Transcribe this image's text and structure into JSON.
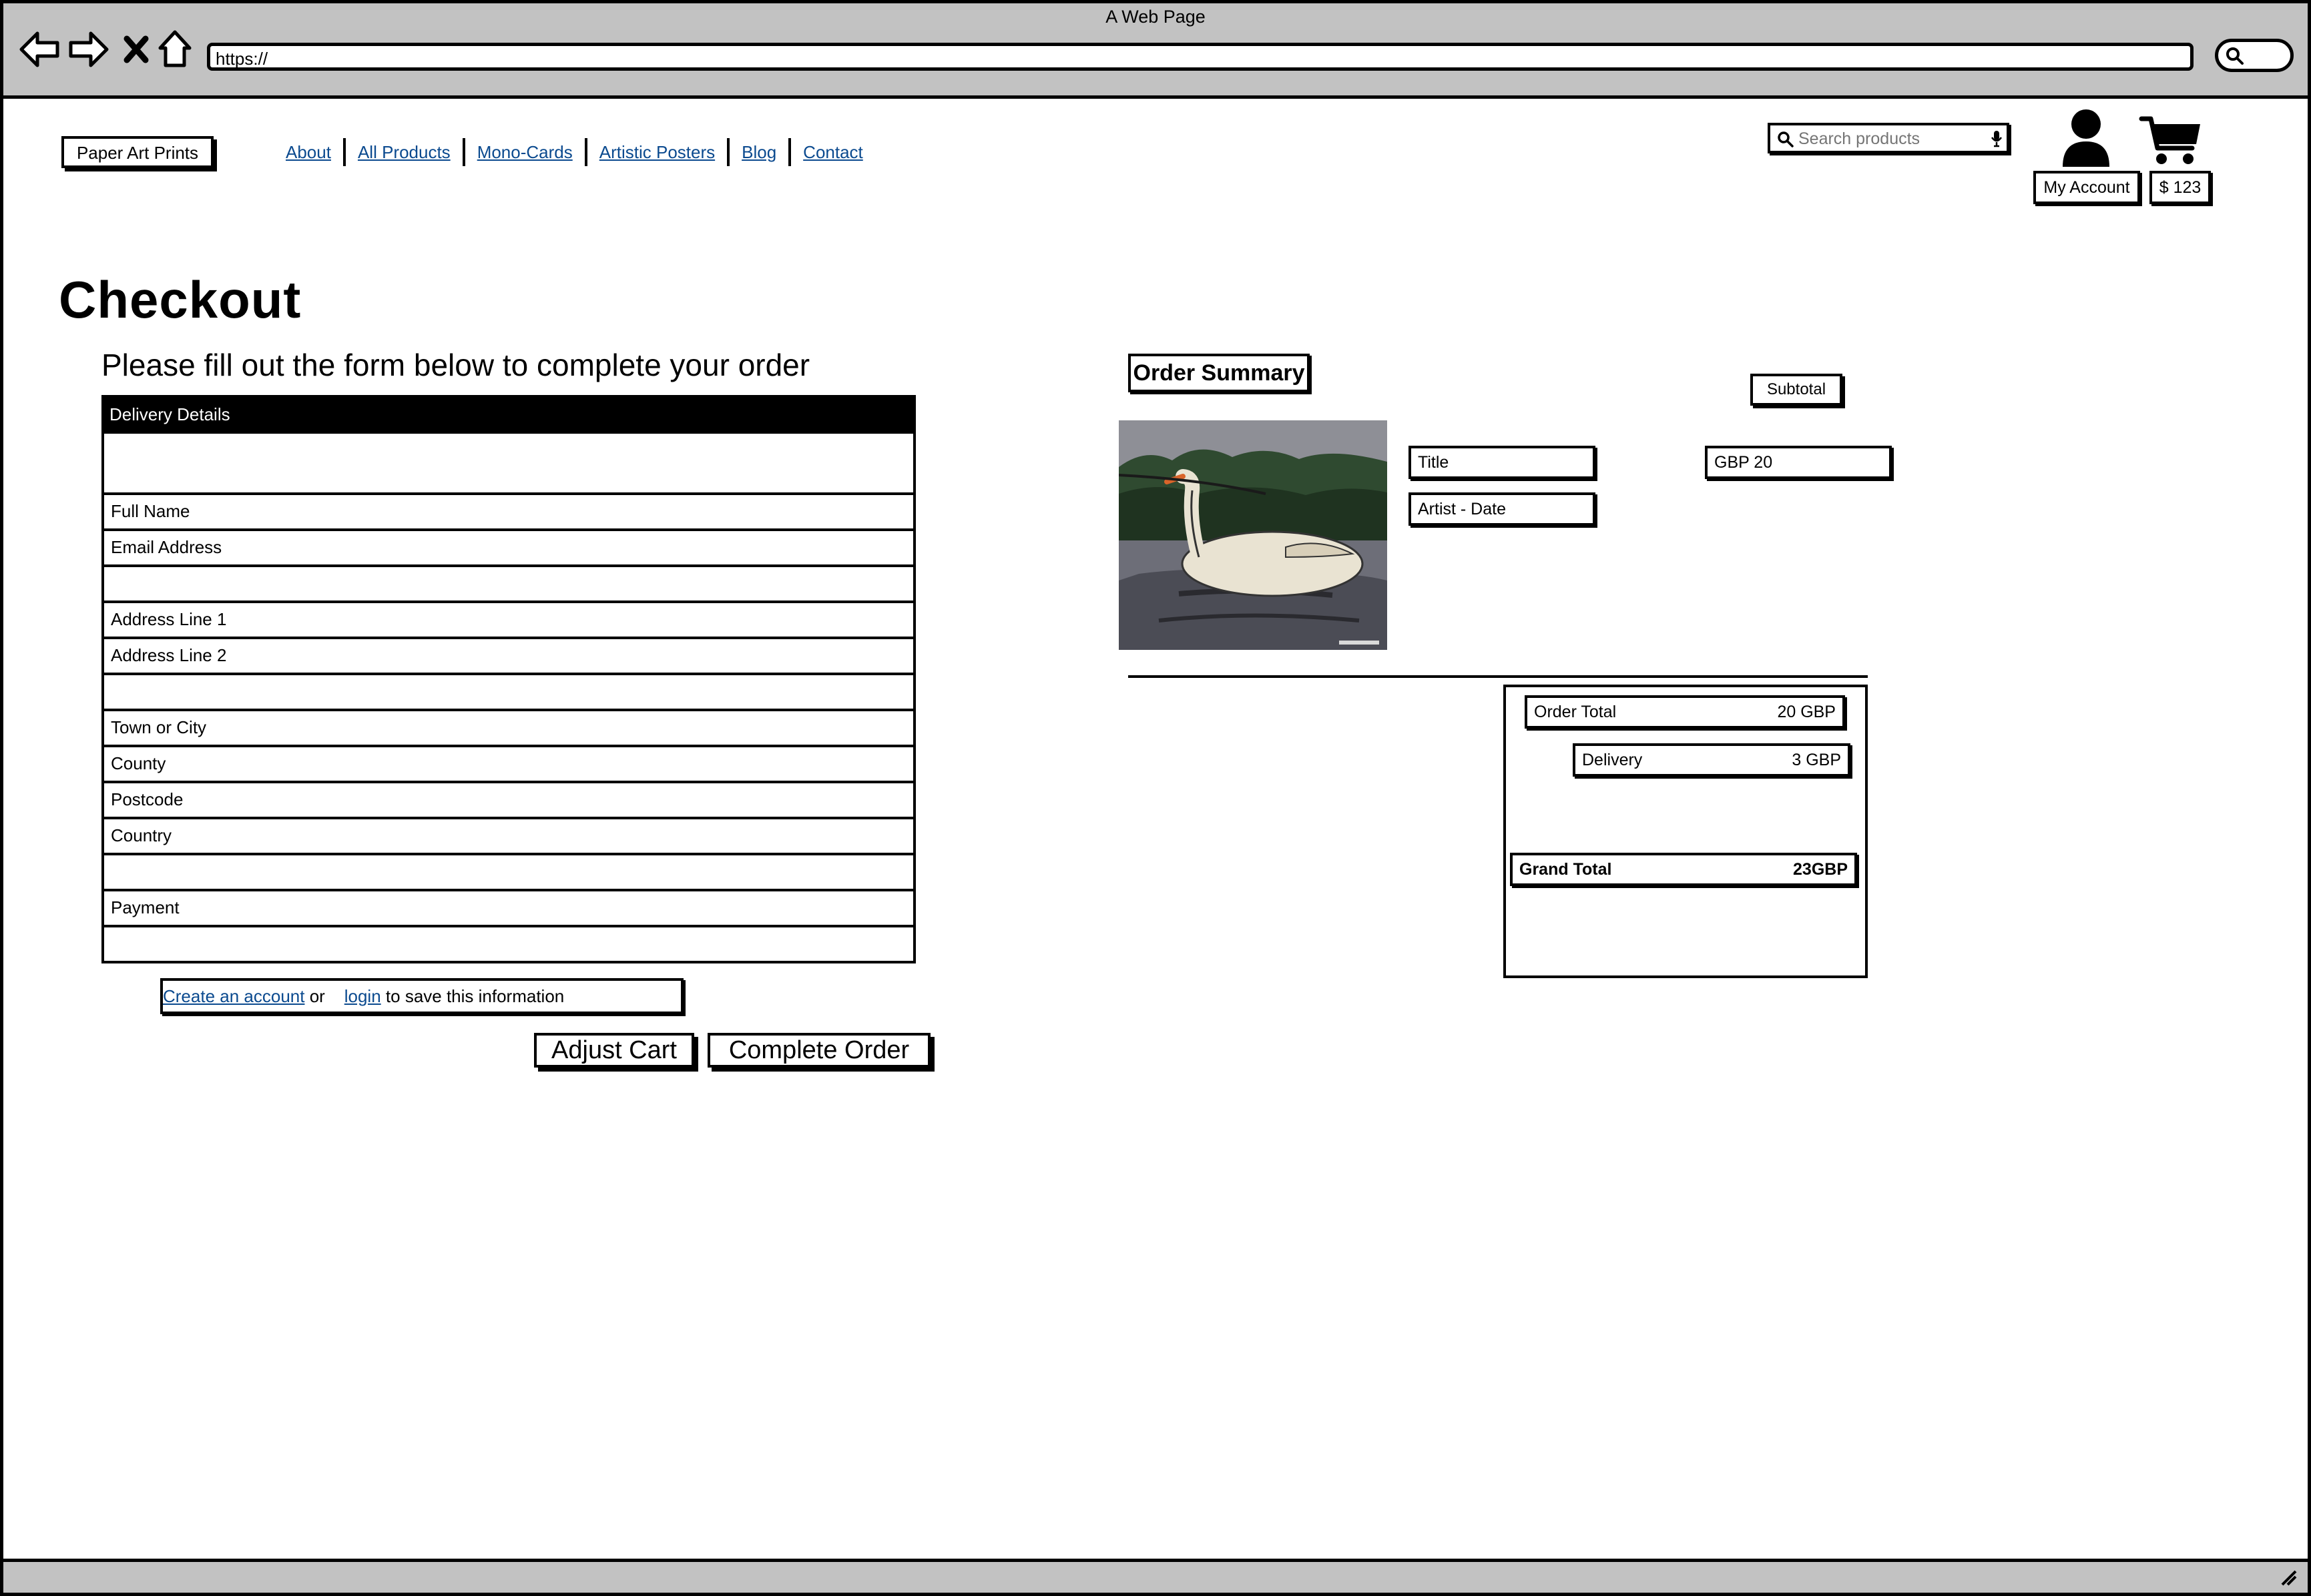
{
  "browser": {
    "window_title": "A Web Page",
    "url": "https://"
  },
  "header": {
    "logo": "Paper Art Prints",
    "nav": [
      "About",
      "All Products",
      "Mono-Cards",
      "Artistic Posters",
      "Blog",
      "Contact"
    ],
    "search_placeholder": "Search products",
    "account_label": "My Account",
    "cart_label": "$ 123"
  },
  "main": {
    "title": "Checkout",
    "intro": "Please fill out the form below to complete your order"
  },
  "form": {
    "header": "Delivery Details",
    "fields": {
      "full_name": "Full Name",
      "email": "Email Address",
      "address1": "Address Line 1",
      "address2": "Address Line 2",
      "town": "Town or City",
      "county": "County",
      "postcode": "Postcode",
      "country": "Country",
      "payment": "Payment"
    },
    "account_note": {
      "create_link": "Create an account",
      "or": "or",
      "login_link": "login",
      "suffix": "to save this information"
    },
    "adjust_cart": "Adjust Cart",
    "complete_order": "Complete Order"
  },
  "summary": {
    "title": "Order Summary",
    "subtotal_label": "Subtotal",
    "item": {
      "title": "Title",
      "artist_date": "Artist - Date",
      "price": "GBP 20"
    },
    "order_total_label": "Order Total",
    "order_total_value": "20 GBP",
    "delivery_label": "Delivery",
    "delivery_value": "3 GBP",
    "grand_total_label": "Grand Total",
    "grand_total_value": "23GBP"
  }
}
